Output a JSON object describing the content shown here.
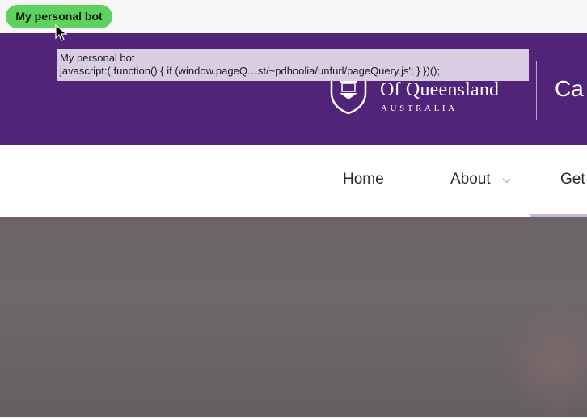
{
  "bookmarks_bar": {
    "bookmark_label": "My personal bot"
  },
  "tooltip": {
    "title": "My personal bot",
    "url": "javascript:( function() { if (window.pageQ…st/~pdhoolia/unfurl/pageQuery.js'; } })();"
  },
  "header": {
    "university_line1": "Of Queensland",
    "university_line2": "AUSTRALIA",
    "site_name_partial": "Ca",
    "brand_color": "#51247a"
  },
  "nav": {
    "items": [
      {
        "label": "Home"
      },
      {
        "label": "About",
        "has_dropdown": true
      },
      {
        "label": "Get"
      }
    ]
  },
  "icons": {
    "crest": "university-crest-icon",
    "chevron": "chevron-down-icon",
    "cursor": "mouse-pointer-icon"
  }
}
